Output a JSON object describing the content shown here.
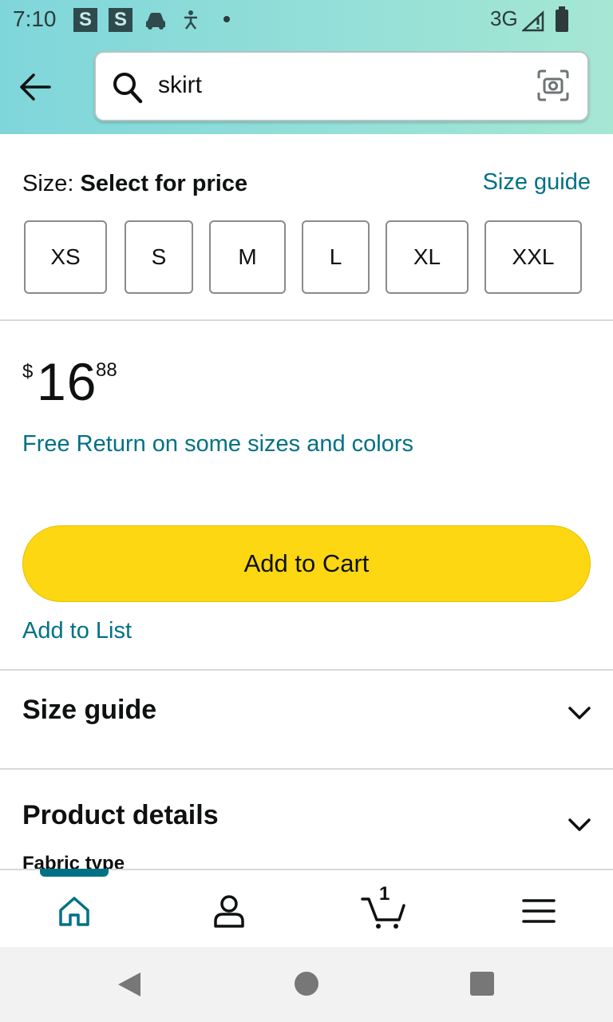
{
  "status_bar": {
    "time": "7:10",
    "icons": [
      "s-notification-icon",
      "s-notification-icon",
      "car-icon",
      "accessibility-icon",
      "dot-icon"
    ],
    "s_label": "S",
    "network": "3G",
    "battery": "battery-icon"
  },
  "header": {
    "back_icon": "arrow-left-icon",
    "search": {
      "value": "skirt",
      "search_icon": "search-icon",
      "camera_icon": "camera-scan-icon"
    }
  },
  "size_selector": {
    "label": "Size:",
    "prompt": "Select for price",
    "guide_link": "Size guide",
    "options": [
      "XS",
      "S",
      "M",
      "L",
      "XL",
      "XXL"
    ]
  },
  "price": {
    "currency": "$",
    "whole": "16",
    "fraction": "88"
  },
  "free_return": "Free Return on some sizes and colors",
  "add_to_cart": "Add to Cart",
  "add_to_list": "Add to List",
  "sections": {
    "size_guide": "Size guide",
    "product_details": "Product details",
    "fabric_type": "Fabric type"
  },
  "bottom_nav": {
    "items": [
      "home-icon",
      "account-icon",
      "cart-icon",
      "menu-icon"
    ],
    "cart_count": "1",
    "active": "home"
  },
  "colors": {
    "accent": "#007185",
    "button": "#fcd712",
    "header_gradient_start": "#7fd6da",
    "header_gradient_end": "#a5e7d3"
  }
}
